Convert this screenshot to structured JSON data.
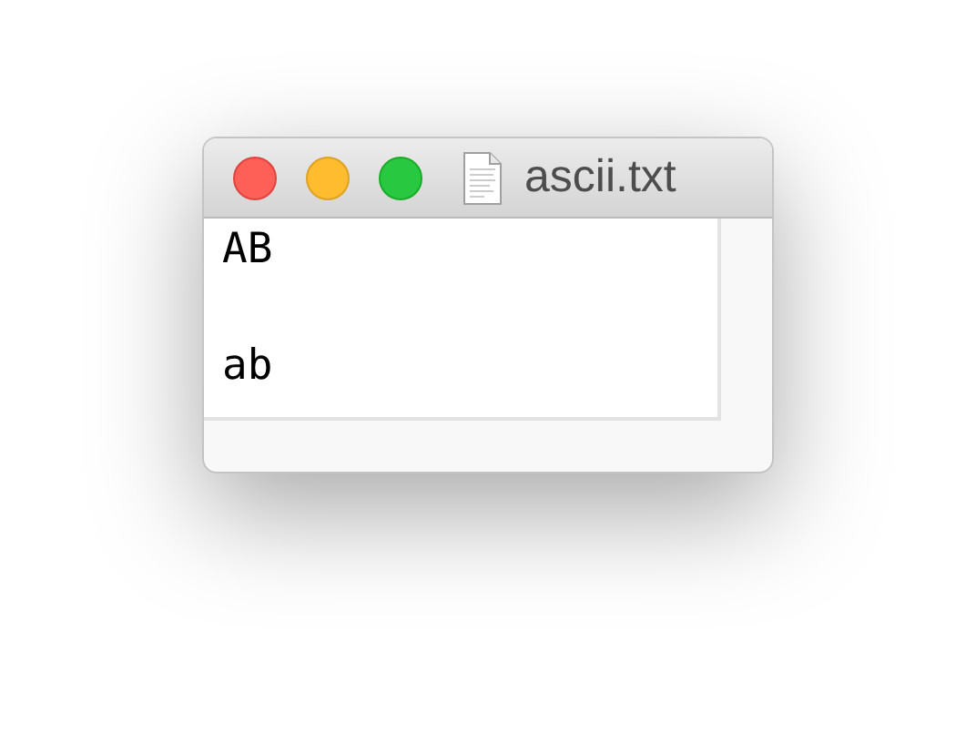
{
  "window": {
    "title": "ascii.txt"
  },
  "document": {
    "lines": [
      {
        "kind": "text",
        "text": "AB"
      },
      {
        "kind": "blank"
      },
      {
        "kind": "text",
        "text": "ab"
      }
    ]
  }
}
